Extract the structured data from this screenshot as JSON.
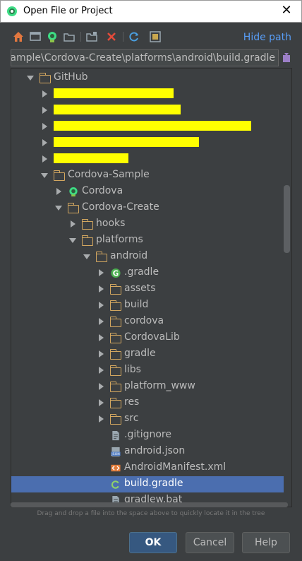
{
  "window": {
    "title": "Open File or Project",
    "close_glyph": "✕"
  },
  "toolbar": {
    "icons": [
      "home-icon",
      "desktop-icon",
      "android-icon",
      "new-folder-icon",
      "new-module-folder-icon",
      "delete-icon",
      "refresh-icon",
      "show-hidden-icon"
    ],
    "hide_path_label": "Hide path"
  },
  "path": {
    "value": "ample\\Cordova-Create\\platforms\\android\\build.gradle"
  },
  "tree": {
    "rows": [
      {
        "label": "GitHub",
        "icon": "folder",
        "arrow": "down",
        "indent": 0
      },
      {
        "label": "",
        "icon": "redacted",
        "arrow": "right",
        "indent": 1
      },
      {
        "label": "",
        "icon": "redacted",
        "arrow": "right",
        "indent": 1
      },
      {
        "label": "",
        "icon": "redacted",
        "arrow": "right",
        "indent": 1
      },
      {
        "label": "",
        "icon": "redacted",
        "arrow": "right",
        "indent": 1
      },
      {
        "label": "",
        "icon": "redacted",
        "arrow": "right",
        "indent": 1
      },
      {
        "label": "Cordova-Sample",
        "icon": "folder",
        "arrow": "down",
        "indent": 1
      },
      {
        "label": "Cordova",
        "icon": "android",
        "arrow": "right",
        "indent": 2
      },
      {
        "label": "Cordova-Create",
        "icon": "folder",
        "arrow": "down",
        "indent": 2
      },
      {
        "label": "hooks",
        "icon": "folder",
        "arrow": "right",
        "indent": 3
      },
      {
        "label": "platforms",
        "icon": "folder",
        "arrow": "down",
        "indent": 3
      },
      {
        "label": "android",
        "icon": "folder",
        "arrow": "down",
        "indent": 4
      },
      {
        "label": ".gradle",
        "icon": "gradle-g",
        "arrow": "right",
        "indent": 5
      },
      {
        "label": "assets",
        "icon": "folder",
        "arrow": "right",
        "indent": 5
      },
      {
        "label": "build",
        "icon": "folder",
        "arrow": "right",
        "indent": 5
      },
      {
        "label": "cordova",
        "icon": "folder",
        "arrow": "right",
        "indent": 5
      },
      {
        "label": "CordovaLib",
        "icon": "folder",
        "arrow": "right",
        "indent": 5
      },
      {
        "label": "gradle",
        "icon": "folder",
        "arrow": "right",
        "indent": 5
      },
      {
        "label": "libs",
        "icon": "folder",
        "arrow": "right",
        "indent": 5
      },
      {
        "label": "platform_www",
        "icon": "folder",
        "arrow": "right",
        "indent": 5
      },
      {
        "label": "res",
        "icon": "folder",
        "arrow": "right",
        "indent": 5
      },
      {
        "label": "src",
        "icon": "folder",
        "arrow": "right",
        "indent": 5
      },
      {
        "label": ".gitignore",
        "icon": "file",
        "arrow": "none",
        "indent": 5
      },
      {
        "label": "android.json",
        "icon": "json",
        "arrow": "none",
        "indent": 5
      },
      {
        "label": "AndroidManifest.xml",
        "icon": "xml",
        "arrow": "none",
        "indent": 5
      },
      {
        "label": "build.gradle",
        "icon": "gradle-file",
        "arrow": "none",
        "indent": 5,
        "selected": true
      },
      {
        "label": "gradlew.bat",
        "icon": "file",
        "arrow": "none",
        "indent": 5
      }
    ]
  },
  "hint": "Drag and drop a file into the space above to quickly locate it in the tree",
  "buttons": {
    "ok": "OK",
    "cancel": "Cancel",
    "help": "Help"
  },
  "colors": {
    "background": "#3c3f41",
    "selection": "#4b6eaf",
    "link": "#589df6",
    "folder": "#d3a760",
    "redaction": "#ffff00"
  }
}
